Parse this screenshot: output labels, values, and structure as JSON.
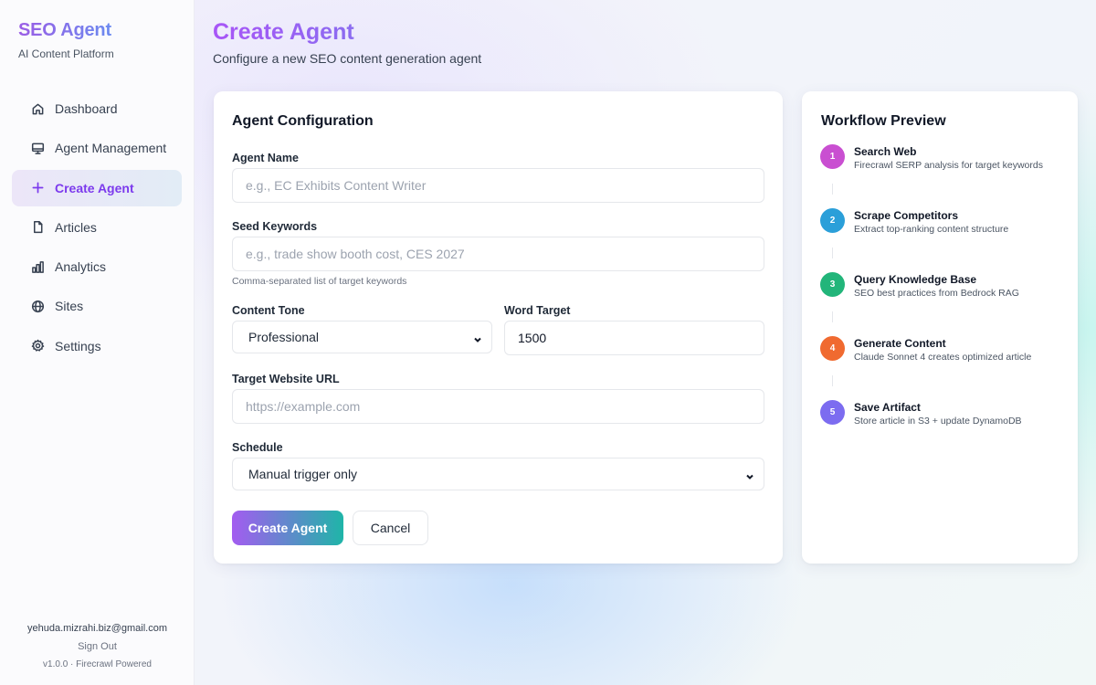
{
  "sidebar": {
    "brand_title": "SEO Agent",
    "brand_subtitle": "AI Content Platform",
    "items": [
      {
        "label": "Dashboard",
        "icon": "home-icon",
        "active": false
      },
      {
        "label": "Agent Management",
        "icon": "monitor-icon",
        "active": false
      },
      {
        "label": "Create Agent",
        "icon": "plus-icon",
        "active": true
      },
      {
        "label": "Articles",
        "icon": "file-icon",
        "active": false
      },
      {
        "label": "Analytics",
        "icon": "bar-chart-icon",
        "active": false
      },
      {
        "label": "Sites",
        "icon": "globe-icon",
        "active": false
      },
      {
        "label": "Settings",
        "icon": "gear-icon",
        "active": false
      }
    ],
    "footer": {
      "email": "yehuda.mizrahi.biz@gmail.com",
      "sign_out": "Sign Out",
      "version": "v1.0.0 · Firecrawl Powered"
    }
  },
  "header": {
    "title": "Create Agent",
    "subtitle": "Configure a new SEO content generation agent"
  },
  "config": {
    "title": "Agent Configuration",
    "agent_name": {
      "label": "Agent Name",
      "placeholder": "e.g., EC Exhibits Content Writer",
      "value": ""
    },
    "seed_keywords": {
      "label": "Seed Keywords",
      "placeholder": "e.g., trade show booth cost, CES 2027",
      "value": "",
      "hint": "Comma-separated list of target keywords"
    },
    "content_tone": {
      "label": "Content Tone",
      "selected": "Professional"
    },
    "word_target": {
      "label": "Word Target",
      "value": "1500"
    },
    "target_url": {
      "label": "Target Website URL",
      "placeholder": "https://example.com",
      "value": ""
    },
    "schedule": {
      "label": "Schedule",
      "selected": "Manual trigger only"
    },
    "create_label": "Create Agent",
    "cancel_label": "Cancel"
  },
  "workflow": {
    "title": "Workflow Preview",
    "steps": [
      {
        "number": "1",
        "title": "Search Web",
        "description": "Firecrawl SERP analysis for target keywords",
        "color": "#c94fd1"
      },
      {
        "number": "2",
        "title": "Scrape Competitors",
        "description": "Extract top-ranking content structure",
        "color": "#2b9fd9"
      },
      {
        "number": "3",
        "title": "Query Knowledge Base",
        "description": "SEO best practices from Bedrock RAG",
        "color": "#22b57a"
      },
      {
        "number": "4",
        "title": "Generate Content",
        "description": "Claude Sonnet 4 creates optimized article",
        "color": "#f06a30"
      },
      {
        "number": "5",
        "title": "Save Artifact",
        "description": "Store article in S3 + update DynamoDB",
        "color": "#7c6cf0"
      }
    ]
  },
  "colors": {
    "accent": "#7c3aed",
    "primary_gradient_start": "#a35cf0",
    "primary_gradient_end": "#1fb5a8"
  }
}
